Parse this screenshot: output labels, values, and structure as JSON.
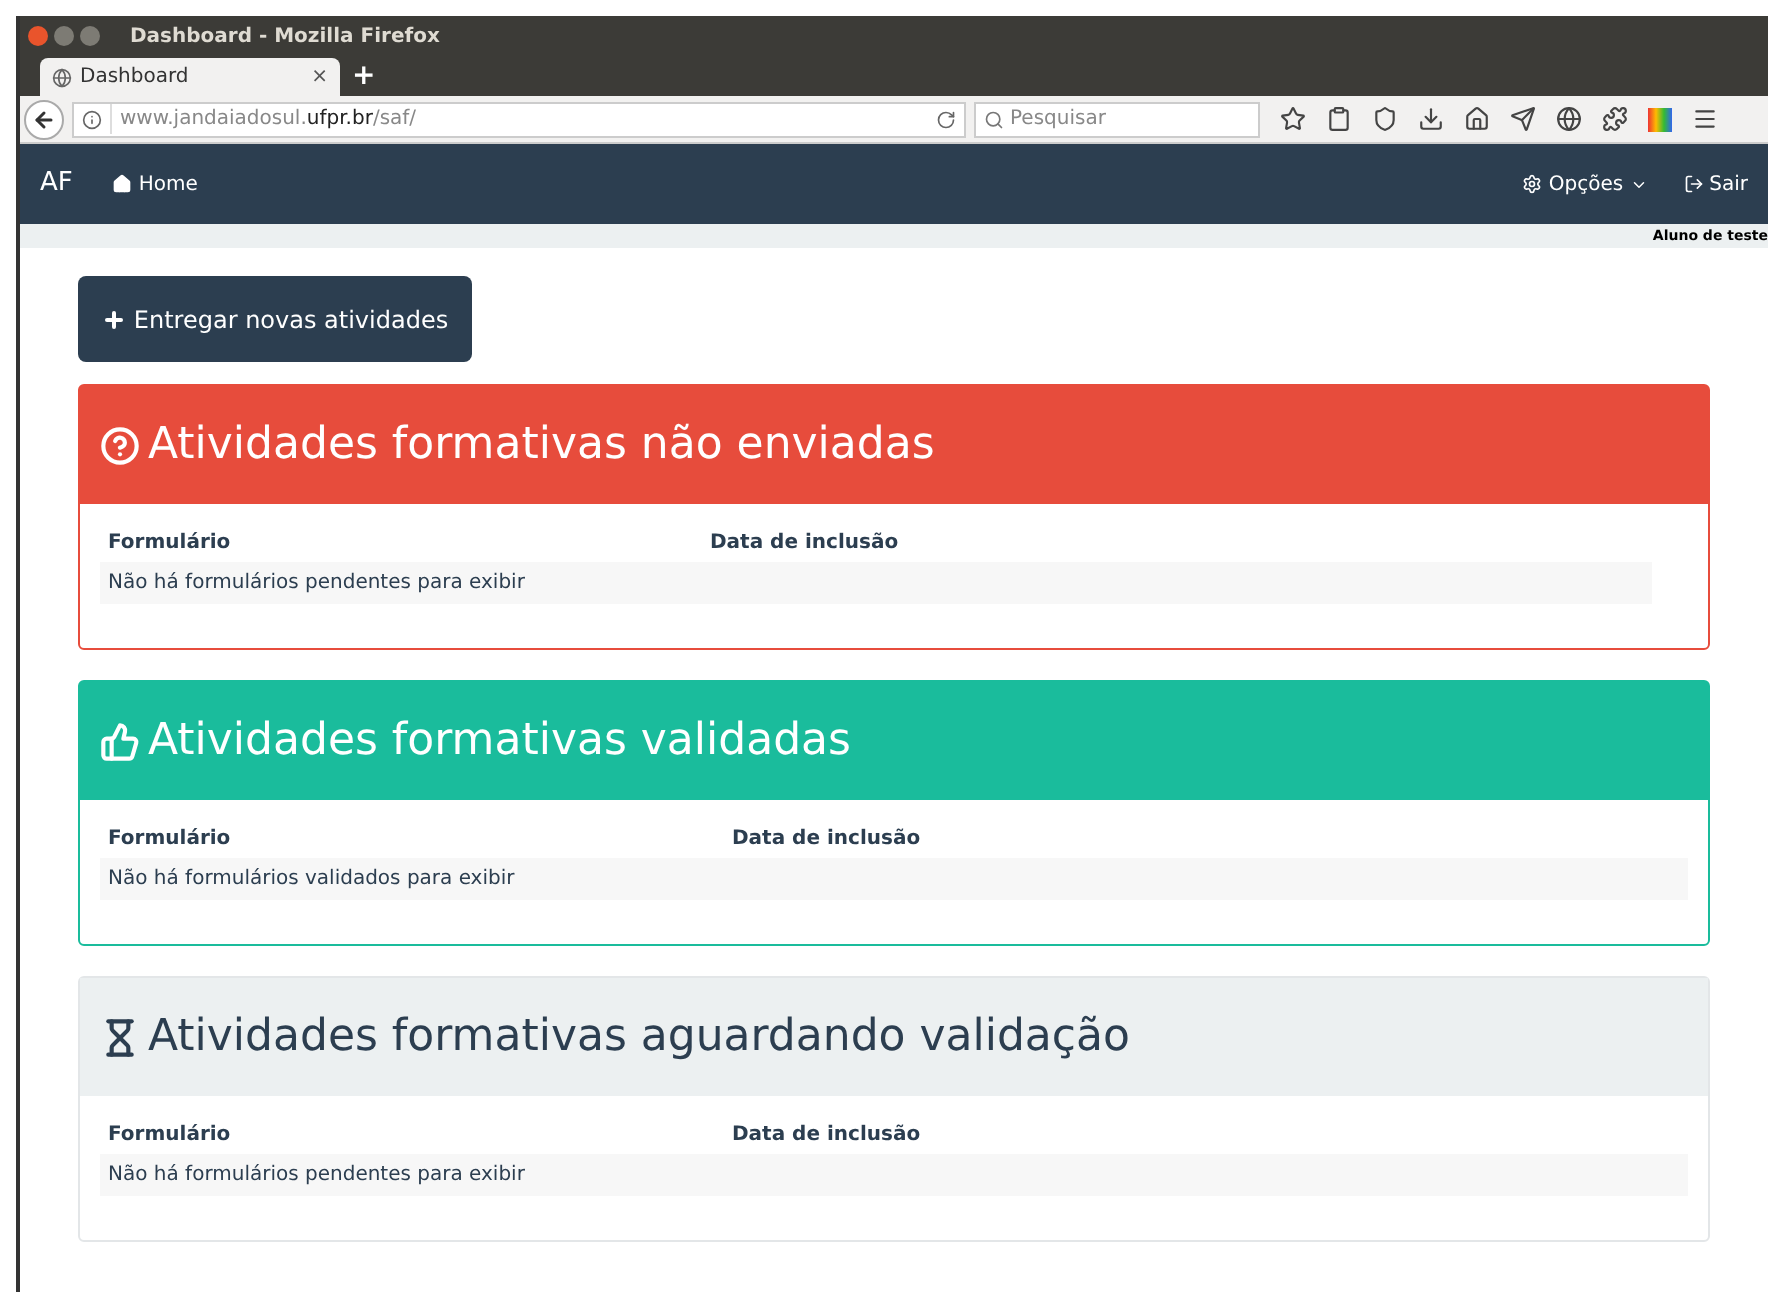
{
  "window": {
    "title": "Dashboard - Mozilla Firefox"
  },
  "tab": {
    "title": "Dashboard",
    "close": "×",
    "new_tab": "+"
  },
  "address": {
    "host": "www.jandaiadosul.",
    "domain": "ufpr.br",
    "path": "/saf/"
  },
  "search": {
    "placeholder": "Pesquisar"
  },
  "navbar": {
    "brand": "AF",
    "home": "Home",
    "options": "Opções",
    "logout": "Sair"
  },
  "user_label": "Aluno de teste",
  "primary_button": "Entregar novas atividades",
  "panels": [
    {
      "kind": "danger",
      "title": "Atividades formativas não enviadas",
      "columns": [
        "Formulário",
        "Data de inclusão"
      ],
      "empty_message": "Não há formulários pendentes para exibir"
    },
    {
      "kind": "success",
      "title": "Atividades formativas validadas",
      "columns": [
        "Formulário",
        "Data de inclusão"
      ],
      "empty_message": "Não há formulários validados para exibir"
    },
    {
      "kind": "pending",
      "title": "Atividades formativas aguardando validação",
      "columns": [
        "Formulário",
        "Data de inclusão"
      ],
      "empty_message": "Não há formulários pendentes para exibir"
    }
  ]
}
